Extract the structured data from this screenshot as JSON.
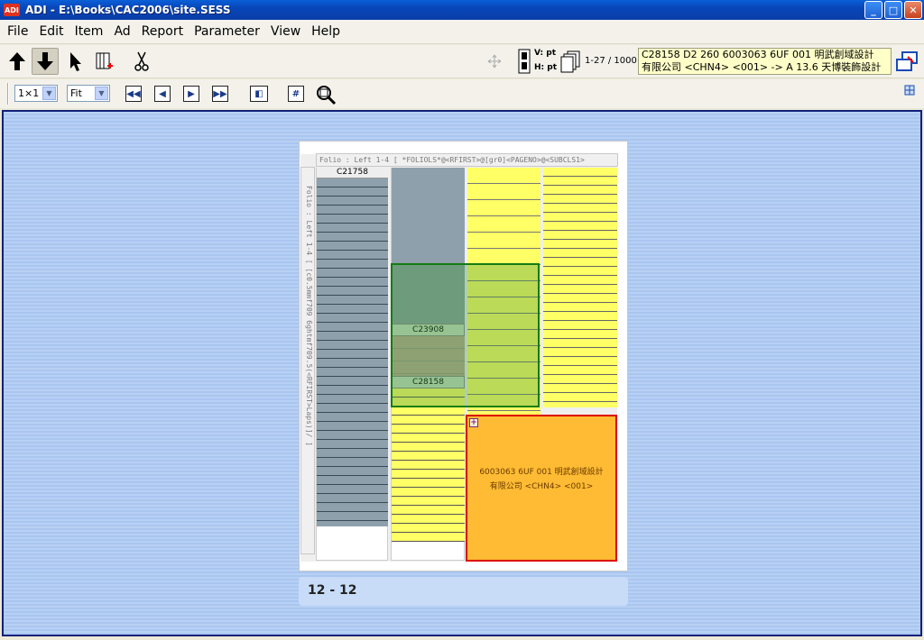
{
  "window": {
    "title": "ADI - E:\\Books\\CAC2006\\site.SESS",
    "logo": "ADI"
  },
  "menu": [
    "File",
    "Edit",
    "Item",
    "Ad",
    "Report",
    "Parameter",
    "View",
    "Help"
  ],
  "toolbar": {
    "v_label": "V: pt",
    "h_label": "H: pt",
    "page_count": "1-27 / 1000",
    "info_line1": "C28158 D2 260 6003063 6UF 001 明武創域設計",
    "info_line2": "有限公司 <CHN4> <001> -> A 13.6 天博裝飾設計"
  },
  "toolbar2": {
    "grid_select": "1×1",
    "zoom_select": "Fit"
  },
  "page": {
    "folio_top": "Folio : Left 1-4 [ *FOLIOLS*@<RFIRST>@[gr0]<PAGENO>@<SUBCLS1>",
    "folio_side": "Folio : Left 1-4 [ [c0.5mmf709 6ghtmf709.5(<RFIRST>Laps)]/  ]",
    "label_c21758": "C21758",
    "label_c23908": "C23908",
    "label_c28158": "C28158",
    "ad_text": "6003063 6UF 001 明武創域設計有限公司 <CHN4> <001>",
    "footer": "12 - 12"
  }
}
